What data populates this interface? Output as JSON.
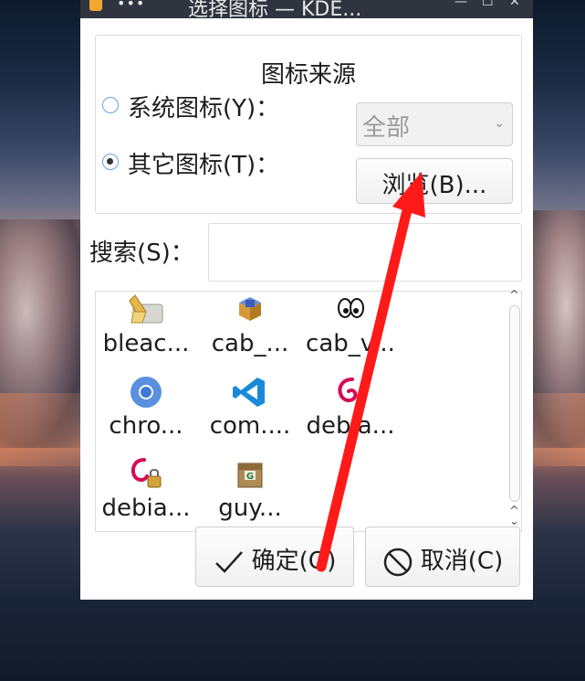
{
  "window": {
    "title": "选择图标 — KDE..."
  },
  "group": {
    "title": "图标来源"
  },
  "system_icons": {
    "label": "系统图标(Y)：",
    "checked": false
  },
  "other_icons": {
    "label": "其它图标(T)：",
    "checked": true
  },
  "combo": {
    "value": "全部"
  },
  "browse_button": {
    "label": "浏览(B)..."
  },
  "search": {
    "label": "搜索(S)：",
    "value": ""
  },
  "icons": [
    {
      "label": "bleac...",
      "icon": "bleachbit-broom-icon"
    },
    {
      "label": "cab_...",
      "icon": "cab-box-icon"
    },
    {
      "label": "cab_v...",
      "icon": "cab-view-eyes-icon"
    },
    {
      "label": "chro...",
      "icon": "chromium-icon"
    },
    {
      "label": "com....",
      "icon": "vscode-icon"
    },
    {
      "label": "debia...",
      "icon": "debian-swirl-icon"
    },
    {
      "label": "debia...",
      "icon": "debian-lock-icon"
    },
    {
      "label": "guy...",
      "icon": "guymager-box-icon"
    }
  ],
  "ok_button": {
    "label": "确定(O)"
  },
  "cancel_button": {
    "label": "取消(C)"
  },
  "colors": {
    "annotation_arrow": "#ff1a1a",
    "radio_border": "#6aa2d8",
    "titlebar": "#2f343f"
  }
}
